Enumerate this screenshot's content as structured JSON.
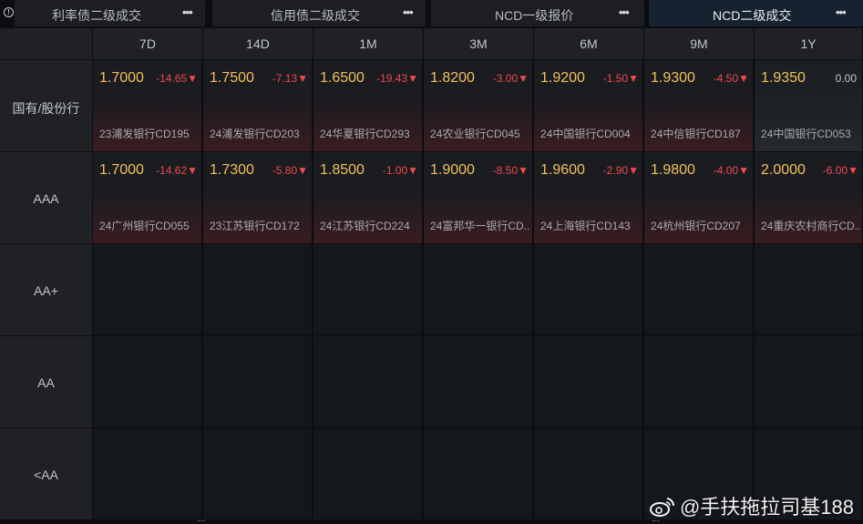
{
  "tabs": [
    {
      "label": "利率债二级成交",
      "more": "•••"
    },
    {
      "label": "信用债二级成交",
      "more": "•••"
    },
    {
      "label": "NCD一级报价",
      "more": "•••"
    },
    {
      "label": "NCD二级成交",
      "more": "•••"
    }
  ],
  "info_icon": "info-icon",
  "columns": [
    "7D",
    "14D",
    "1M",
    "3M",
    "6M",
    "9M",
    "1Y"
  ],
  "rows": [
    {
      "label": "国有/股份行",
      "cells": [
        {
          "rate": "1.7000",
          "change": "-14.65▼",
          "bond": "23浦发银行CD195"
        },
        {
          "rate": "1.7500",
          "change": "-7.13▼",
          "bond": "24浦发银行CD203"
        },
        {
          "rate": "1.6500",
          "change": "-19.43▼",
          "bond": "24华夏银行CD293"
        },
        {
          "rate": "1.8200",
          "change": "-3.00▼",
          "bond": "24农业银行CD045"
        },
        {
          "rate": "1.9200",
          "change": "-1.50▼",
          "bond": "24中国银行CD004"
        },
        {
          "rate": "1.9300",
          "change": "-4.50▼",
          "bond": "24中信银行CD187"
        },
        {
          "rate": "1.9350",
          "change": "0.00",
          "bond": "24中国银行CD053",
          "neutral": true
        }
      ]
    },
    {
      "label": "AAA",
      "cells": [
        {
          "rate": "1.7000",
          "change": "-14.62▼",
          "bond": "24广州银行CD055"
        },
        {
          "rate": "1.7300",
          "change": "-5.80▼",
          "bond": "23江苏银行CD172"
        },
        {
          "rate": "1.8500",
          "change": "-1.00▼",
          "bond": "24江苏银行CD224"
        },
        {
          "rate": "1.9000",
          "change": "-8.50▼",
          "bond": "24富邦华一银行CD.."
        },
        {
          "rate": "1.9600",
          "change": "-2.90▼",
          "bond": "24上海银行CD143"
        },
        {
          "rate": "1.9800",
          "change": "-4.00▼",
          "bond": "24杭州银行CD207"
        },
        {
          "rate": "2.0000",
          "change": "-6.00▼",
          "bond": "24重庆农村商行CD.."
        }
      ]
    },
    {
      "label": "AA+",
      "cells": []
    },
    {
      "label": "AA",
      "cells": []
    },
    {
      "label": "<AA",
      "cells": []
    }
  ],
  "watermark": "@手扶拖拉司基188",
  "watermark_icon": "weibo-icon",
  "colors": {
    "rate": "#f3c05a",
    "change_down": "#f0484f",
    "active_tab": "#16222f"
  }
}
